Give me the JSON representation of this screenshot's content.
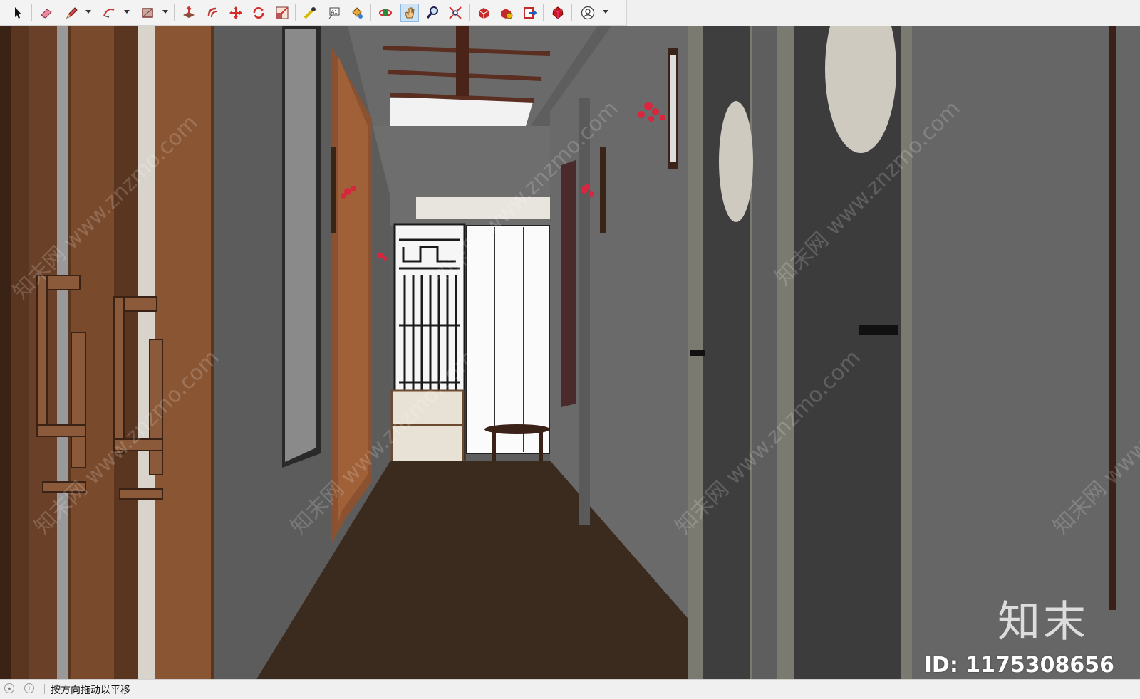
{
  "toolbar": {
    "tools": [
      {
        "name": "select-tool",
        "icon": "arrow-cursor-icon"
      },
      {
        "name": "eraser-tool",
        "icon": "eraser-icon"
      },
      {
        "name": "line-tool",
        "icon": "pencil-icon",
        "dropdown": true
      },
      {
        "name": "arc-tool",
        "icon": "arc-icon",
        "dropdown": true
      },
      {
        "name": "shape-tool",
        "icon": "rectangle-icon",
        "dropdown": true
      },
      {
        "name": "push-pull-tool",
        "icon": "push-pull-icon"
      },
      {
        "name": "offset-tool",
        "icon": "offset-icon"
      },
      {
        "name": "move-tool",
        "icon": "move-icon"
      },
      {
        "name": "rotate-tool",
        "icon": "rotate-icon"
      },
      {
        "name": "scale-tool",
        "icon": "scale-icon"
      },
      {
        "name": "tape-measure-tool",
        "icon": "tape-measure-icon"
      },
      {
        "name": "text-tool",
        "icon": "text-icon"
      },
      {
        "name": "paint-bucket-tool",
        "icon": "paint-bucket-icon"
      },
      {
        "name": "orbit-tool",
        "icon": "orbit-icon"
      },
      {
        "name": "pan-tool",
        "icon": "hand-icon",
        "active": true
      },
      {
        "name": "zoom-tool",
        "icon": "magnifier-icon"
      },
      {
        "name": "zoom-extents-tool",
        "icon": "zoom-extents-icon"
      },
      {
        "name": "warehouse-tool",
        "icon": "3d-warehouse-icon"
      },
      {
        "name": "extension-warehouse-tool",
        "icon": "extension-warehouse-icon"
      },
      {
        "name": "send-to-layout-tool",
        "icon": "layout-icon"
      },
      {
        "name": "ruby-console-tool",
        "icon": "ruby-icon"
      },
      {
        "name": "account-tool",
        "icon": "user-icon",
        "dropdown": true
      }
    ],
    "text_label_icon": "A1"
  },
  "viewport": {
    "watermark_text": "知末网 www.znzmo.com",
    "brand_text": "知末",
    "id_text": "ID: 1175308656"
  },
  "status": {
    "message": "按方向拖动以平移"
  },
  "colors": {
    "wall": "#5e5e5e",
    "floor": "#3a2a1e",
    "wood": "#7a4a2c",
    "door": "#3e3e3e",
    "flower": "#d8263e",
    "active_tool_bg": "#cfe3f7"
  }
}
